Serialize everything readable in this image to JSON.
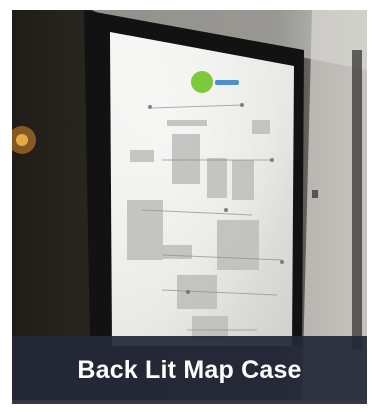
{
  "caption": {
    "text": "Back Lit Map Case"
  },
  "photo": {
    "subject": "illuminated map case on a wall",
    "logo_icon": "circular-green-logo-icon"
  }
}
